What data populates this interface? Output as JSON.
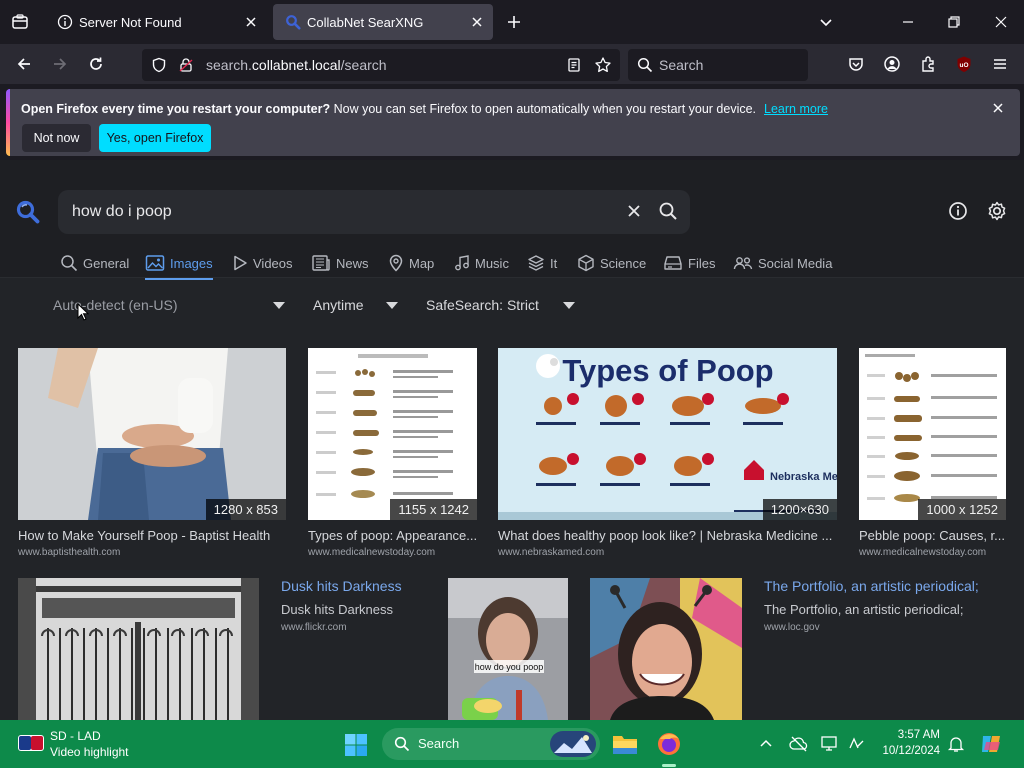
{
  "browser": {
    "tabs": [
      {
        "title": "Server Not Found",
        "active": false
      },
      {
        "title": "CollabNet SearXNG",
        "active": true
      }
    ],
    "url_prefix": "search.",
    "url_domain": "collabnet.local",
    "url_path": "/search",
    "search_placeholder": "Search"
  },
  "notification": {
    "bold": "Open Firefox every time you restart your computer?",
    "text": " Now you can set Firefox to open automatically when you restart your device.",
    "learn_more": "Learn more",
    "not_now": "Not now",
    "yes": "Yes, open Firefox"
  },
  "search": {
    "query": "how do i poop"
  },
  "categories": [
    {
      "label": "General",
      "icon": "search-icon"
    },
    {
      "label": "Images",
      "icon": "image-icon",
      "active": true
    },
    {
      "label": "Videos",
      "icon": "play-icon"
    },
    {
      "label": "News",
      "icon": "newspaper-icon"
    },
    {
      "label": "Map",
      "icon": "map-pin-icon"
    },
    {
      "label": "Music",
      "icon": "music-icon"
    },
    {
      "label": "It",
      "icon": "layers-icon"
    },
    {
      "label": "Science",
      "icon": "cube-icon"
    },
    {
      "label": "Files",
      "icon": "drive-icon"
    },
    {
      "label": "Social Media",
      "icon": "people-icon"
    }
  ],
  "filters": {
    "language": "Auto-detect (en-US)",
    "time": "Anytime",
    "safesearch": "SafeSearch: Strict"
  },
  "results_row1": [
    {
      "title": "How to Make Yourself Poop - Baptist Health",
      "url": "www.baptisthealth.com",
      "size": "1280 x 853"
    },
    {
      "title": "Types of poop: Appearance...",
      "url": "www.medicalnewstoday.com",
      "size": "1155 x 1242"
    },
    {
      "title": "What does healthy poop look like? | Nebraska Medicine ...",
      "url": "www.nebraskamed.com",
      "size": "1200×630"
    },
    {
      "title": "Pebble poop: Causes, r...",
      "url": "www.medicalnewstoday.com",
      "size": "1000 x 1252"
    }
  ],
  "results_row2": [
    {
      "link": "Dusk hits Darkness",
      "title": "Dusk hits Darkness",
      "url": "www.flickr.com"
    },
    {
      "link": "The Portfolio, an artistic periodical;",
      "title": "The Portfolio, an artistic periodical;",
      "url": "www.loc.gov"
    }
  ],
  "image_texts": {
    "types_title": "Types of Poop",
    "nebraska": "Nebraska Medicine",
    "video_caption": "how do you poop"
  },
  "taskbar": {
    "widget_title": "SD - LAD",
    "widget_sub": "Video highlight",
    "search": "Search",
    "time": "3:57 AM",
    "date": "10/12/2024"
  },
  "colors": {
    "accent_blue": "#5e9ded",
    "firefox_cyan": "#00ddff",
    "taskbar_green": "#0d8a4a"
  }
}
